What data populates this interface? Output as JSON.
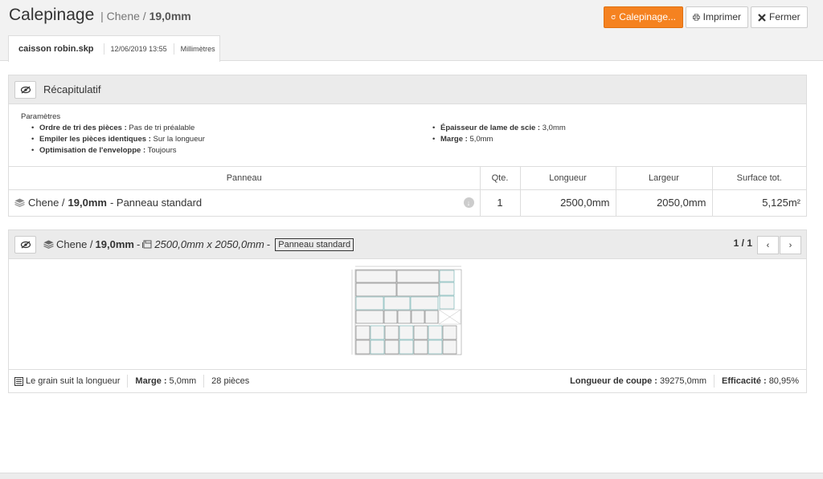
{
  "header": {
    "title": "Calepinage",
    "separator": "|",
    "material": "Chene /",
    "thickness": "19,0mm",
    "buttons": {
      "calepinage": "Calepinage...",
      "print": "Imprimer",
      "close": "Fermer"
    },
    "accent_color": "#f58220"
  },
  "tab": {
    "filename": "caisson robin.skp",
    "date": "12/06/2019 13:55",
    "units": "Millimètres"
  },
  "summary": {
    "title": "Récapitulatif",
    "params_label": "Paramètres",
    "params_left": [
      {
        "key": "Ordre de tri des pièces :",
        "value": "Pas de tri préalable"
      },
      {
        "key": "Empiler les pièces identiques :",
        "value": "Sur la longueur"
      },
      {
        "key": "Optimisation de l'enveloppe :",
        "value": "Toujours"
      }
    ],
    "params_right": [
      {
        "key": "Épaisseur de lame de scie :",
        "value": "3,0mm"
      },
      {
        "key": "Marge :",
        "value": "5,0mm"
      }
    ],
    "columns": {
      "panneau": "Panneau",
      "qte": "Qte.",
      "longueur": "Longueur",
      "largeur": "Largeur",
      "surface": "Surface tot."
    },
    "row": {
      "material": "Chene /",
      "thickness": "19,0mm",
      "type": "- Panneau standard",
      "qty": "1",
      "length": "2500,0mm",
      "width": "2050,0mm",
      "surface": "5,125m²"
    }
  },
  "sheet": {
    "material": "Chene /",
    "thickness": "19,0mm",
    "separator": "-",
    "dimensions": "2500,0mm x 2050,0mm",
    "separator2": "-",
    "tag": "Panneau standard",
    "pager": "1 / 1",
    "prev_icon": "‹",
    "next_icon": "›",
    "footer": {
      "grain": "Le grain suit la longueur",
      "marge_label": "Marge :",
      "marge_value": "5,0mm",
      "pieces": "28 pièces",
      "cut_label": "Longueur de coupe :",
      "cut_value": "39275,0mm",
      "eff_label": "Efficacité :",
      "eff_value": "80,95%"
    }
  }
}
